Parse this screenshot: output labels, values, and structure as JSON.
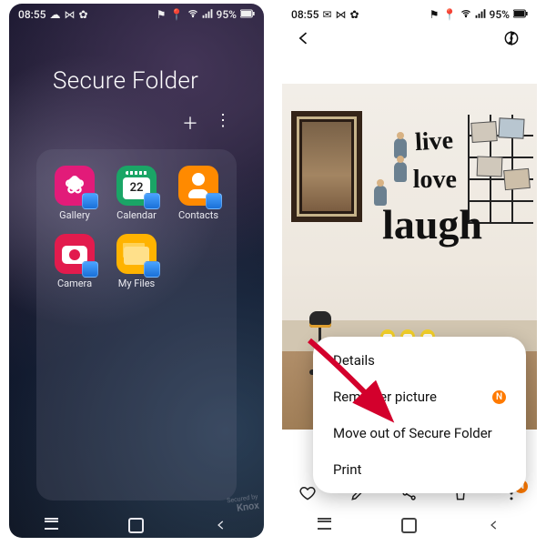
{
  "status": {
    "time": "08:55",
    "left_icons": [
      "cloud",
      "bowtie",
      "gear"
    ],
    "right_icons": [
      "flag",
      "location",
      "wifi",
      "signal"
    ],
    "battery_pct": "95%"
  },
  "left_screen": {
    "title": "Secure Folder",
    "apps": [
      {
        "label": "Gallery",
        "icon": "gallery-icon"
      },
      {
        "label": "Calendar",
        "icon": "calendar-icon",
        "day": "22"
      },
      {
        "label": "Contacts",
        "icon": "contacts-icon"
      },
      {
        "label": "Camera",
        "icon": "camera-icon"
      },
      {
        "label": "My Files",
        "icon": "files-icon"
      }
    ],
    "watermark_small": "Secured by",
    "watermark_brand": "Knox"
  },
  "right_screen": {
    "photo_words": {
      "w1": "live",
      "w2": "love",
      "w3": "laugh"
    },
    "menu": [
      {
        "label": "Details",
        "badge": false
      },
      {
        "label": "Remaster picture",
        "badge": true
      },
      {
        "label": "Move out of Secure Folder",
        "badge": false
      },
      {
        "label": "Print",
        "badge": false
      }
    ],
    "toolbar": [
      "favorite",
      "edit",
      "share",
      "delete",
      "more"
    ],
    "badge_char": "N"
  }
}
